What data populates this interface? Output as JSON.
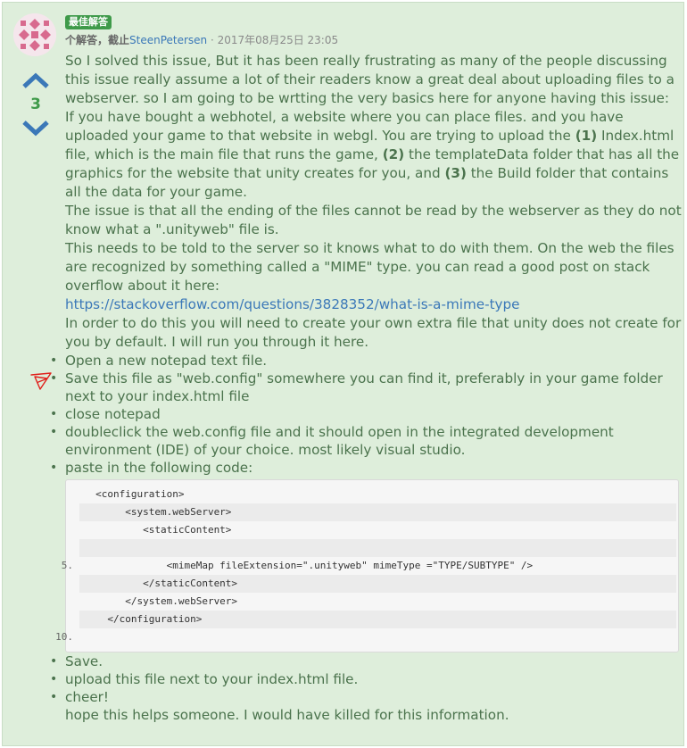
{
  "answer": {
    "badge": "最佳解答",
    "meta_prefix": "个解答，截止",
    "author": "SteenPetersen",
    "date": "· 2017年08月25日 23:05",
    "votes": "3",
    "intro": "So I solved this issue, But it has been really frustrating as many of the people discussing this issue really assume a lot of their readers know a great deal about uploading files to a webserver. so I am going to be wrtting the very basics here for anyone having this issue:",
    "p2_a": "If you have bought a webhotel, a website where you can place files. and you have uploaded your game to that website in webgl. You are trying to upload the ",
    "p2_b1": "(1)",
    "p2_c": " Index.html file, which is the main file that runs the game, ",
    "p2_b2": "(2)",
    "p2_d": " the templateData folder that has all the graphics for the website that unity creates for you, and ",
    "p2_b3": "(3)",
    "p2_e": " the Build folder that contains all the data for your game.",
    "p3": "The issue is that all the ending of the files cannot be read by the webserver as they do not know what a \".unityweb\" file is.",
    "p4": "This needs to be told to the server so it knows what to do with them. On the web the files are recognized by something called a \"MIME\" type. you can read a good post on stack overflow about it here:",
    "link": "https://stackoverflow.com/questions/3828352/what-is-a-mime-type",
    "p5": "In order to do this you will need to create your own extra file that unity does not create for you by default. I will run you through it here.",
    "steps": [
      "Open a new notepad text file.",
      "Save this file as \"web.config\" somewhere you can find it, preferably in your game folder next to your index.html file",
      "close notepad",
      "doubleclick the web.config file and it should open in the integrated development environment (IDE) of your choice. most likely visual studio.",
      "paste in the following code:"
    ],
    "code": [
      "     <configuration>",
      "          <system.webServer>",
      "             <staticContent>",
      "",
      "                 <mimeMap fileExtension=\".unityweb\" mimeType =\"TYPE/SUBTYPE\" />",
      "             </staticContent>",
      "          </system.webServer>",
      "       </configuration>",
      "",
      ""
    ],
    "line_numbers": {
      "5": "5.",
      "10": "10."
    },
    "tail_steps": [
      "Save.",
      "upload this file next to your index.html file.",
      "cheer!"
    ],
    "closing": "hope this helps someone. I would have killed for this information."
  }
}
